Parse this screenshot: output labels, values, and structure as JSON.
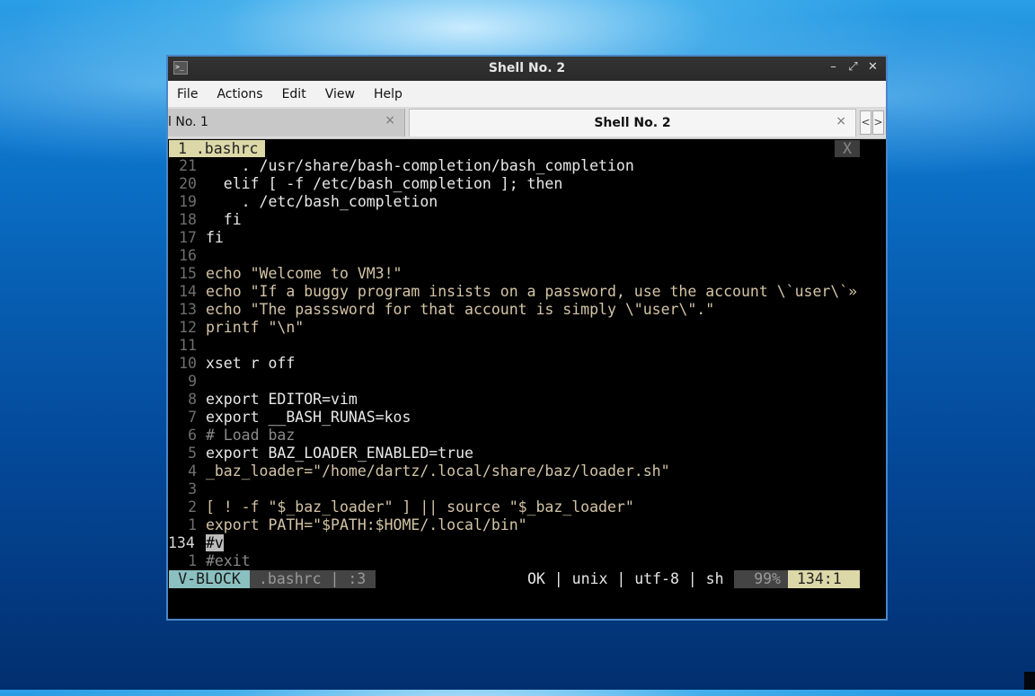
{
  "window": {
    "title": "Shell No. 2",
    "app_icon_glyph": ">_",
    "buttons": {
      "minimize": "–",
      "maximize": "⤢",
      "close": "✕"
    }
  },
  "menu": [
    "File",
    "Actions",
    "Edit",
    "View",
    "Help"
  ],
  "tabs": [
    {
      "label": "l No. 1",
      "close": "×"
    },
    {
      "label": "Shell No. 2",
      "close": "×"
    }
  ],
  "tab_scroll": {
    "left": "<",
    "right": ">"
  },
  "editor": {
    "buffer_tab": "1 .bashrc",
    "buffer_close": "X",
    "lines": [
      {
        "n": "21",
        "t": "    . /usr/share/bash-completion/bash_completion"
      },
      {
        "n": "20",
        "t": "  elif [ -f /etc/bash_completion ]; then"
      },
      {
        "n": "19",
        "t": "    . /etc/bash_completion"
      },
      {
        "n": "18",
        "t": "  fi"
      },
      {
        "n": "17",
        "t": "fi"
      },
      {
        "n": "16",
        "t": ""
      },
      {
        "n": "15",
        "t": "echo \"Welcome to VM3!\""
      },
      {
        "n": "14",
        "t": "echo \"If a buggy program insists on a password, use the account \\`user\\`»"
      },
      {
        "n": "13",
        "t": "echo \"The passsword for that account is simply \\\"user\\\".\""
      },
      {
        "n": "12",
        "t": "printf \"\\n\""
      },
      {
        "n": "11",
        "t": ""
      },
      {
        "n": "10",
        "t": "xset r off"
      },
      {
        "n": "9",
        "t": ""
      },
      {
        "n": "8",
        "t": "export EDITOR=vim"
      },
      {
        "n": "7",
        "t": "export __BASH_RUNAS=kos"
      },
      {
        "n": "6",
        "t": "# Load baz"
      },
      {
        "n": "5",
        "t": "export BAZ_LOADER_ENABLED=true"
      },
      {
        "n": "4",
        "t": "_baz_loader=\"/home/dartz/.local/share/baz/loader.sh\""
      },
      {
        "n": "3",
        "t": ""
      },
      {
        "n": "2",
        "t": "[ ! -f \"$_baz_loader\" ] || source \"$_baz_loader\""
      },
      {
        "n": "1",
        "t": "export PATH=\"$PATH:$HOME/.local/bin\""
      },
      {
        "n": "134",
        "t": "#v"
      },
      {
        "n": "1",
        "t": "#exit"
      }
    ],
    "status": {
      "mode": "V-BLOCK",
      "file": ".bashrc | :3",
      "info": "OK | unix | utf-8 | sh",
      "percent": "99%",
      "position": "134:1"
    }
  }
}
